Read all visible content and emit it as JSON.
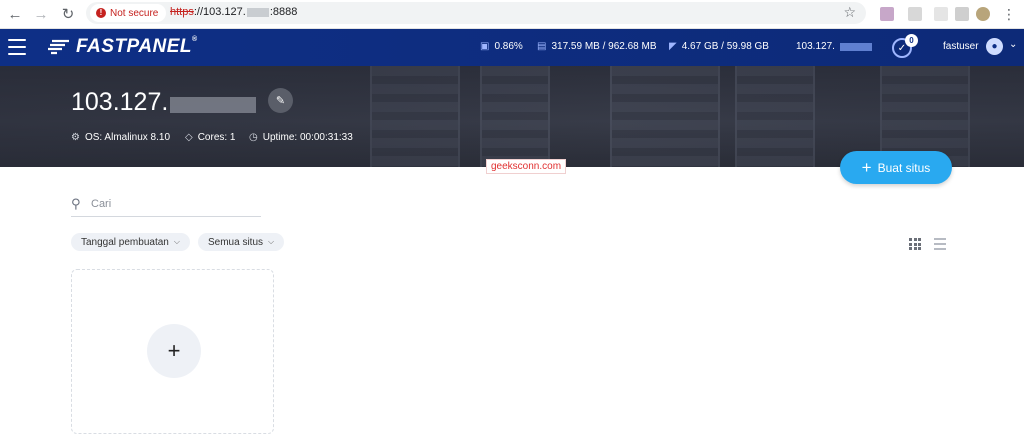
{
  "browser": {
    "security_label": "Not secure",
    "url_scheme": "https",
    "url_host": "://103.127.",
    "url_port": ":8888"
  },
  "header": {
    "logo": "FASTPANEL",
    "logo_mark": "®",
    "cpu": "0.86%",
    "memory": "317.59 MB / 962.68 MB",
    "disk": "4.67 GB / 59.98 GB",
    "ip": "103.127.",
    "notifications_count": "0",
    "username": "fastuser"
  },
  "server": {
    "name": "103.127.",
    "os": "OS: Almalinux 8.10",
    "cores": "Cores: 1",
    "uptime": "Uptime: 00:00:31:33"
  },
  "watermark": "geeksconn.com",
  "main": {
    "create_button": "Buat situs",
    "search_placeholder": "Cari",
    "filters": [
      "Tanggal pembuatan",
      "Semua situs"
    ]
  },
  "colors": {
    "header_bg": "#0e2f86",
    "accent": "#29a9f0",
    "insecure": "#c5221f"
  },
  "icons": {
    "back": "arrow-left-icon",
    "forward": "arrow-right-icon",
    "reload": "reload-icon",
    "star": "star-icon",
    "menu": "hamburger-icon",
    "cpu": "cpu-icon",
    "ram": "memory-icon",
    "disk": "disk-icon",
    "notifications": "check-circle-icon",
    "user": "user-icon",
    "edit": "pencil-icon",
    "os": "gear-icon",
    "cores": "diamond-icon",
    "uptime": "clock-icon",
    "search": "search-icon",
    "grid_view": "grid-icon",
    "list_view": "list-icon",
    "add": "plus-icon"
  }
}
